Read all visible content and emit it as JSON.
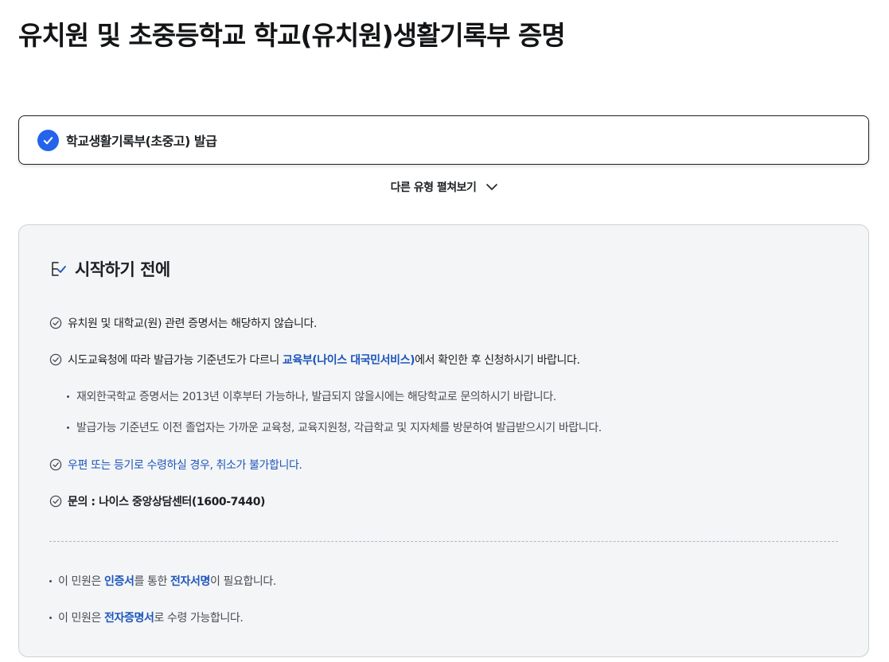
{
  "page_title": "유치원 및 초중등학교 학교(유치원)생활기록부 증명",
  "selected_option": {
    "label": "학교생활기록부(초중고) 발급",
    "icon": "check-circle-icon",
    "accent_color": "#2563eb"
  },
  "expand_toggle": {
    "label": "다른 유형 펼쳐보기",
    "icon": "chevron-down-icon"
  },
  "info": {
    "title": "시작하기 전에",
    "title_icon": "checklist-icon",
    "items": [
      {
        "text": "유치원 및 대학교(원) 관련 증명서는 해당하지 않습니다."
      },
      {
        "before": "시도교육청에 따라 발급가능 기준년도가 다르니 ",
        "link": "교육부(나이스 대국민서비스)",
        "after": "에서 확인한 후 신청하시기 바랍니다."
      },
      {
        "text": "우편 또는 등기로 수령하실 경우, 취소가 불가합니다."
      },
      {
        "text": "문의 : 나이스 중앙상담센터(1600-7440)"
      }
    ],
    "sub_items": [
      "재외한국학교 증명서는 2013년 이후부터 가능하나, 발급되지 않을시에는 해당학교로 문의하시기 바랍니다.",
      "발급가능 기준년도 이전 졸업자는 가까운 교육청, 교육지원청, 각급학교 및 지자체를 방문하여 발급받으시기 바랍니다."
    ],
    "notes": [
      {
        "before": "이 민원은 ",
        "em1": "인증서",
        "middle": "를 통한 ",
        "em2": "전자서명",
        "after": "이 필요합니다."
      },
      {
        "before": "이 민원은 ",
        "em1": "전자증명서",
        "after": "로 수령 가능합니다."
      }
    ]
  }
}
